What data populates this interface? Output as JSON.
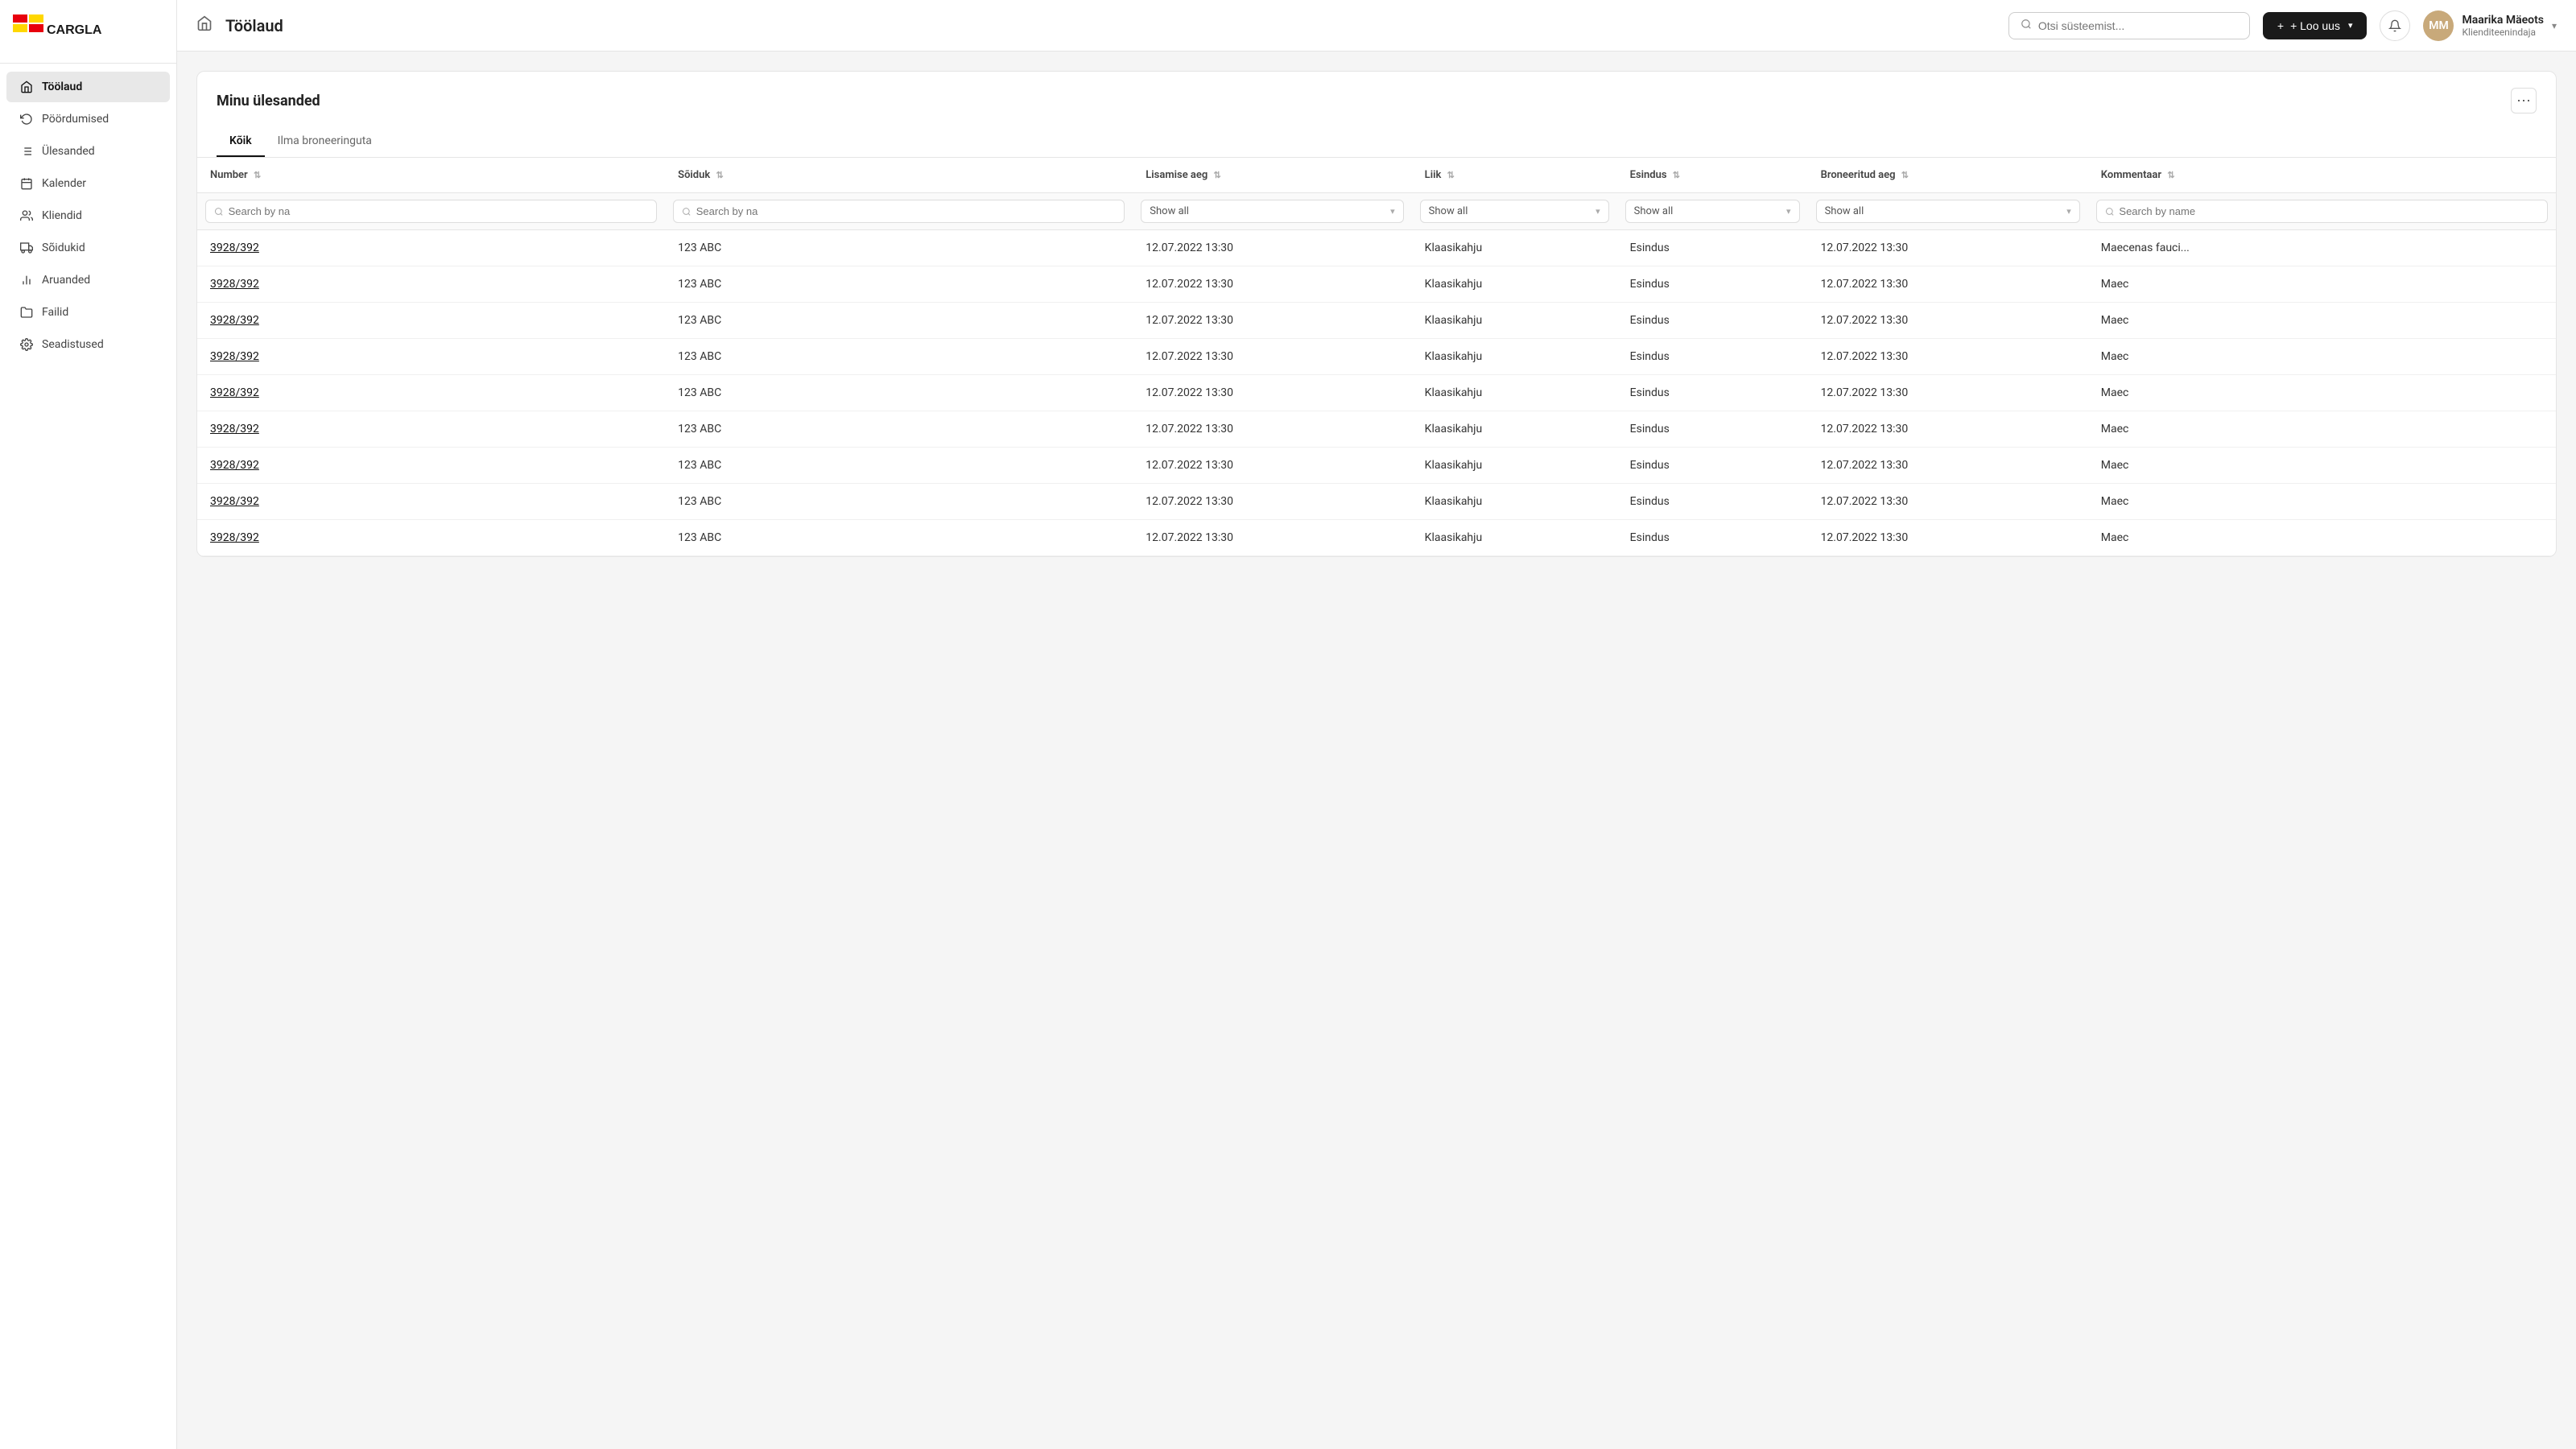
{
  "sidebar": {
    "logo_text": "CARGLASS",
    "items": [
      {
        "id": "toolaud",
        "label": "Töölaud",
        "icon": "home",
        "active": true
      },
      {
        "id": "poordumised",
        "label": "Pöördumised",
        "icon": "refresh-cw"
      },
      {
        "id": "ulesanded",
        "label": "Ülesanded",
        "icon": "list"
      },
      {
        "id": "kalender",
        "label": "Kalender",
        "icon": "calendar"
      },
      {
        "id": "kliendid",
        "label": "Kliendid",
        "icon": "users"
      },
      {
        "id": "soidukid",
        "label": "Sõidukid",
        "icon": "truck"
      },
      {
        "id": "aruanded",
        "label": "Aruanded",
        "icon": "bar-chart"
      },
      {
        "id": "failid",
        "label": "Failid",
        "icon": "folder"
      },
      {
        "id": "seadistused",
        "label": "Seadistused",
        "icon": "settings"
      }
    ]
  },
  "header": {
    "title": "Töölaud",
    "search_placeholder": "Otsi süsteemist...",
    "btn_new_label": "+ Loo uus",
    "user": {
      "name": "Maarika Mäeots",
      "role": "Klienditeenindaja",
      "avatar_initials": "MM"
    }
  },
  "main": {
    "card_title": "Minu ülesanded",
    "tabs": [
      {
        "id": "koik",
        "label": "Kõik",
        "active": true
      },
      {
        "id": "ilma",
        "label": "Ilma broneeringuta",
        "active": false
      }
    ],
    "table": {
      "columns": [
        {
          "id": "number",
          "label": "Number",
          "filter_type": "search",
          "filter_placeholder": "Search by na"
        },
        {
          "id": "soiduk",
          "label": "Sõiduk",
          "filter_type": "search",
          "filter_placeholder": "Search by na"
        },
        {
          "id": "lisamise_aeg",
          "label": "Lisamise aeg",
          "filter_type": "select",
          "filter_value": "Show all"
        },
        {
          "id": "liik",
          "label": "Liik",
          "filter_type": "select",
          "filter_value": "Show all"
        },
        {
          "id": "esindus",
          "label": "Esindus",
          "filter_type": "select",
          "filter_value": "Show all"
        },
        {
          "id": "broneeritud_aeg",
          "label": "Broneeritud aeg",
          "filter_type": "select",
          "filter_value": "Show all"
        },
        {
          "id": "kommentaar",
          "label": "Kommentaar",
          "filter_type": "search",
          "filter_placeholder": "Search by name"
        }
      ],
      "rows": [
        {
          "number": "3928/392",
          "soiduk": "123 ABC",
          "lisamise_aeg": "12.07.2022 13:30",
          "liik": "Klaasikahju",
          "esindus": "Esindus",
          "broneeritud_aeg": "12.07.2022 13:30",
          "kommentaar": "Maecenas fauci..."
        },
        {
          "number": "3928/392",
          "soiduk": "123 ABC",
          "lisamise_aeg": "12.07.2022 13:30",
          "liik": "Klaasikahju",
          "esindus": "Esindus",
          "broneeritud_aeg": "12.07.2022 13:30",
          "kommentaar": "Maec"
        },
        {
          "number": "3928/392",
          "soiduk": "123 ABC",
          "lisamise_aeg": "12.07.2022 13:30",
          "liik": "Klaasikahju",
          "esindus": "Esindus",
          "broneeritud_aeg": "12.07.2022 13:30",
          "kommentaar": "Maec"
        },
        {
          "number": "3928/392",
          "soiduk": "123 ABC",
          "lisamise_aeg": "12.07.2022 13:30",
          "liik": "Klaasikahju",
          "esindus": "Esindus",
          "broneeritud_aeg": "12.07.2022 13:30",
          "kommentaar": "Maec"
        },
        {
          "number": "3928/392",
          "soiduk": "123 ABC",
          "lisamise_aeg": "12.07.2022 13:30",
          "liik": "Klaasikahju",
          "esindus": "Esindus",
          "broneeritud_aeg": "12.07.2022 13:30",
          "kommentaar": "Maec"
        },
        {
          "number": "3928/392",
          "soiduk": "123 ABC",
          "lisamise_aeg": "12.07.2022 13:30",
          "liik": "Klaasikahju",
          "esindus": "Esindus",
          "broneeritud_aeg": "12.07.2022 13:30",
          "kommentaar": "Maec"
        },
        {
          "number": "3928/392",
          "soiduk": "123 ABC",
          "lisamise_aeg": "12.07.2022 13:30",
          "liik": "Klaasikahju",
          "esindus": "Esindus",
          "broneeritud_aeg": "12.07.2022 13:30",
          "kommentaar": "Maec"
        },
        {
          "number": "3928/392",
          "soiduk": "123 ABC",
          "lisamise_aeg": "12.07.2022 13:30",
          "liik": "Klaasikahju",
          "esindus": "Esindus",
          "broneeritud_aeg": "12.07.2022 13:30",
          "kommentaar": "Maec"
        },
        {
          "number": "3928/392",
          "soiduk": "123 ABC",
          "lisamise_aeg": "12.07.2022 13:30",
          "liik": "Klaasikahju",
          "esindus": "Esindus",
          "broneeritud_aeg": "12.07.2022 13:30",
          "kommentaar": "Maec"
        }
      ]
    }
  },
  "icons": {
    "home": "⌂",
    "refresh": "↻",
    "list": "≡",
    "calendar": "📅",
    "users": "👥",
    "truck": "🚗",
    "bar_chart": "📊",
    "folder": "📁",
    "settings": "⚙",
    "search": "🔍",
    "bell": "🔔",
    "plus": "+",
    "chevron_down": "▾",
    "more": "⋮",
    "sort": "⇅"
  }
}
